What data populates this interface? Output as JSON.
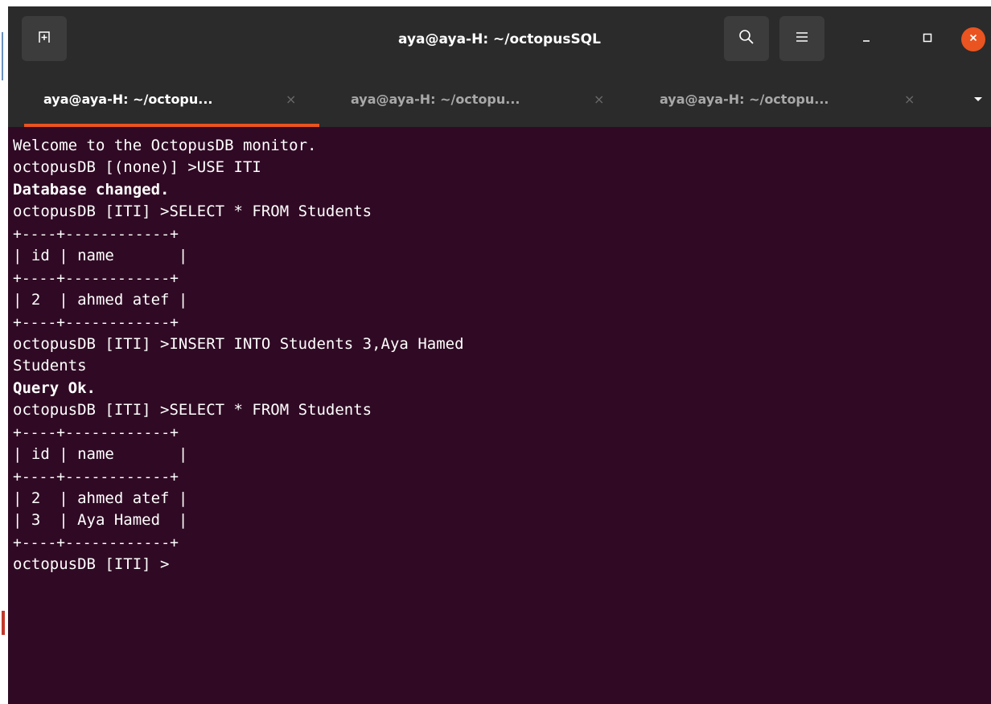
{
  "window": {
    "title": "aya@aya-H: ~/octopusSQL"
  },
  "toolbar": {
    "new_tab_icon": "new-tab-icon",
    "search_icon": "search-icon",
    "menu_icon": "hamburger-menu-icon",
    "minimize_icon": "minimize-icon",
    "maximize_icon": "maximize-icon",
    "close_icon": "close-icon"
  },
  "tabs": [
    {
      "label": "aya@aya-H: ~/octopu...",
      "close": "×",
      "active": true
    },
    {
      "label": "aya@aya-H: ~/octopu...",
      "close": "×",
      "active": false
    },
    {
      "label": "aya@aya-H: ~/octopu...",
      "close": "×",
      "active": false
    }
  ],
  "terminal": {
    "lines": [
      "Welcome to the OctopusDB monitor.",
      "octopusDB [(none)] >USE ITI",
      "Database changed.",
      "octopusDB [ITI] >SELECT * FROM Students",
      "+----+------------+",
      "| id | name       |",
      "+----+------------+",
      "| 2  | ahmed atef |",
      "+----+------------+",
      "octopusDB [ITI] >INSERT INTO Students 3,Aya Hamed",
      "Students",
      "Query Ok.",
      "octopusDB [ITI] >SELECT * FROM Students",
      "+----+------------+",
      "| id | name       |",
      "+----+------------+",
      "| 2  | ahmed atef |",
      "| 3  | Aya Hamed  |",
      "+----+------------+",
      "octopusDB [ITI] >"
    ]
  },
  "colors": {
    "terminal_bg": "#300a24",
    "titlebar_bg": "#2b2b2b",
    "accent": "#e95420"
  }
}
